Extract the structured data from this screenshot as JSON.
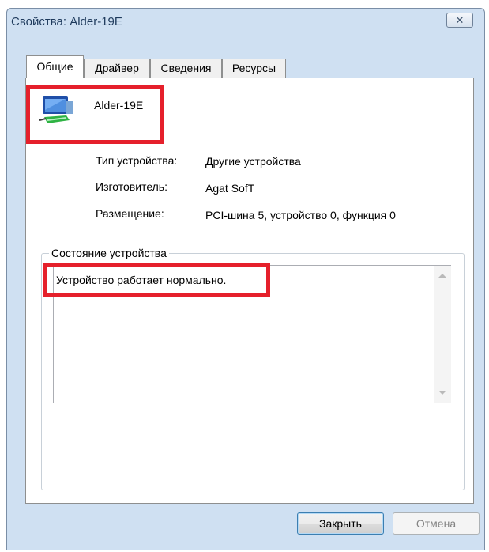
{
  "window": {
    "title": "Свойства: Alder-19E",
    "close_glyph": "✕"
  },
  "tabs": [
    {
      "label": "Общие",
      "active": true
    },
    {
      "label": "Драйвер",
      "active": false
    },
    {
      "label": "Сведения",
      "active": false
    },
    {
      "label": "Ресурсы",
      "active": false
    }
  ],
  "device": {
    "name": "Alder-19E",
    "icon": "network-device-icon",
    "type_label": "Тип устройства:",
    "type_value": "Другие устройства",
    "manufacturer_label": "Изготовитель:",
    "manufacturer_value": "Agat SofT",
    "location_label": "Размещение:",
    "location_value": "PCI-шина 5, устройство 0, функция 0"
  },
  "status": {
    "group_title": "Состояние устройства",
    "text": "Устройство работает нормально."
  },
  "buttons": {
    "close": "Закрыть",
    "cancel": "Отмена"
  },
  "colors": {
    "highlight": "#e5202b",
    "frame": "#cfe0f2"
  }
}
